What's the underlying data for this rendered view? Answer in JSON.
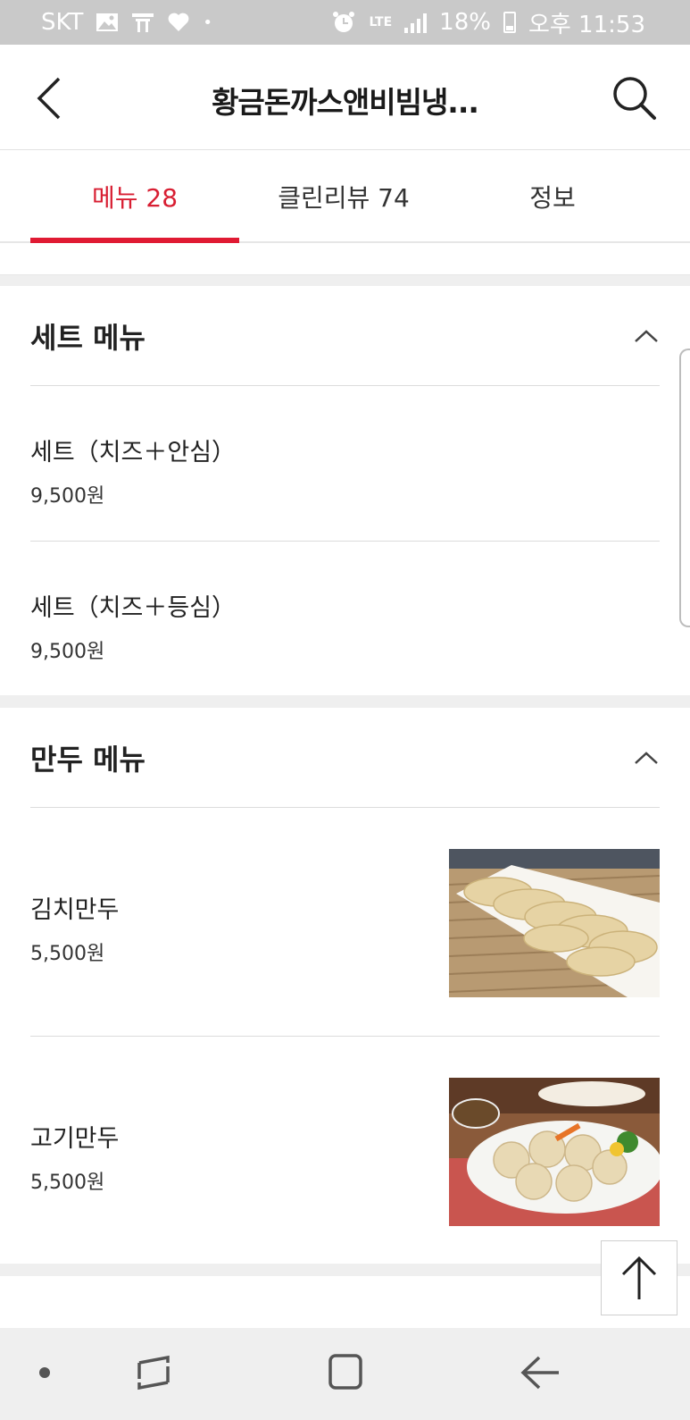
{
  "status_bar": {
    "carrier": "SKT",
    "network": "LTE",
    "battery": "18%",
    "time": "오후 11:53",
    "left_icons": [
      "image-icon",
      "t-app-icon",
      "heart-icon",
      "dot-icon"
    ],
    "right_icons": [
      "alarm-icon",
      "lte-icon",
      "signal-icon",
      "battery-icon"
    ]
  },
  "header": {
    "title": "황금돈까스앤비빔냉...",
    "back_icon": "back-arrow-icon",
    "search_icon": "search-icon"
  },
  "tabs": [
    {
      "label": "메뉴 28",
      "active": true
    },
    {
      "label": "클린리뷰 74",
      "active": false
    },
    {
      "label": "정보",
      "active": false
    }
  ],
  "colors": {
    "accent": "#e01a33",
    "active_tab_text": "#d81e32",
    "divider": "#efefef"
  },
  "sections": [
    {
      "title": "세트 메뉴",
      "expanded": true,
      "items": [
        {
          "name": "세트（치즈＋안심）",
          "price": "9,500원"
        },
        {
          "name": "세트（치즈＋등심）",
          "price": "9,500원"
        }
      ]
    },
    {
      "title": "만두 메뉴",
      "expanded": true,
      "items": [
        {
          "name": "김치만두",
          "price": "5,500원",
          "image": "kimchi-dumpling-photo"
        },
        {
          "name": "고기만두",
          "price": "5,500원",
          "image": "meat-dumpling-photo"
        }
      ]
    }
  ],
  "scroll_top_icon": "arrow-up-icon",
  "nav_bar": [
    "dot-icon",
    "recent-apps-icon",
    "home-icon",
    "back-icon"
  ]
}
